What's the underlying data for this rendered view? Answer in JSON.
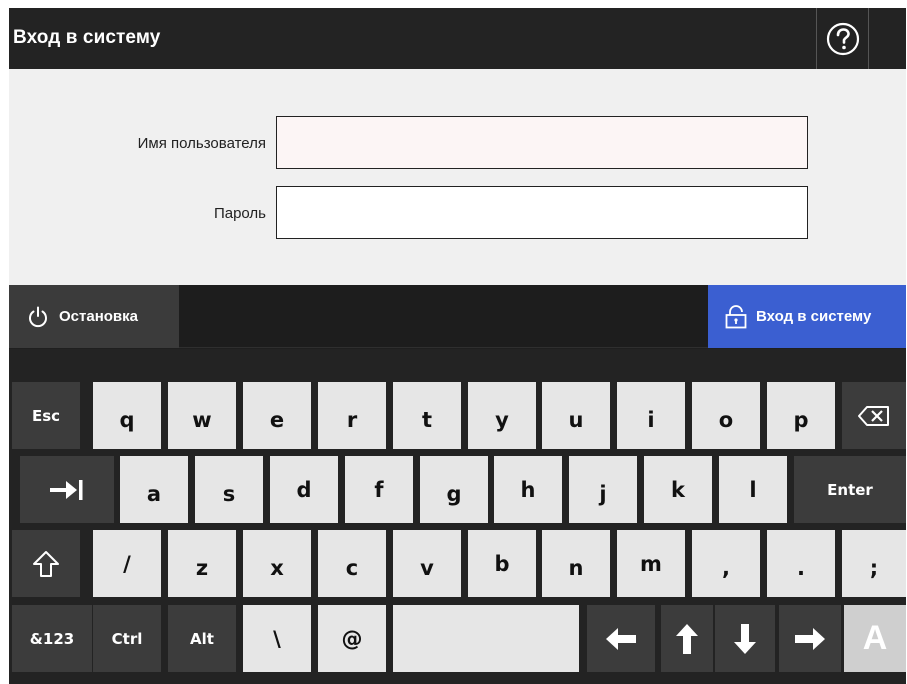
{
  "window": {
    "title": "Вход в систему",
    "help_icon": "question-circle-icon"
  },
  "form": {
    "username_label": "Имя пользователя",
    "username_value": "",
    "password_label": "Пароль",
    "password_value": ""
  },
  "actions": {
    "stop_label": "Остановка",
    "stop_icon": "power-icon",
    "login_label": "Вход в систему",
    "login_icon": "unlock-icon",
    "login_color": "#3b5fd1"
  },
  "keyboard": {
    "row1": [
      "Esc",
      "q",
      "w",
      "e",
      "r",
      "t",
      "y",
      "u",
      "i",
      "o",
      "p",
      "backspace-icon"
    ],
    "row2": [
      "tab-icon",
      "a",
      "s",
      "d",
      "f",
      "g",
      "h",
      "j",
      "k",
      "l",
      "Enter"
    ],
    "row3": [
      "shift-icon",
      "/",
      "z",
      "x",
      "c",
      "v",
      "b",
      "n",
      "m",
      ",",
      ".",
      ";"
    ],
    "row4": [
      "&123",
      "Ctrl",
      "Alt",
      "\\",
      "@",
      "space",
      "arrow-left-icon",
      "arrow-up-icon",
      "arrow-down-icon",
      "arrow-right-icon",
      "A"
    ]
  }
}
